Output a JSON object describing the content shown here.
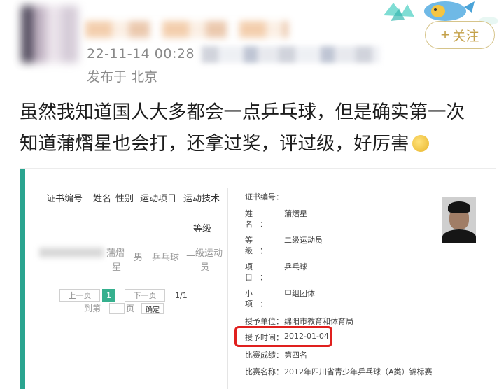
{
  "post": {
    "timestamp": "22-11-14 00:28",
    "location": "发布于 北京",
    "follow_label": "关注",
    "text_line1": "虽然我知道国人大多都会一点乒乓球，但是确实第一次",
    "text_line2": "知道蒲熠星也会打，还拿过奖，评过级，好厉害"
  },
  "certificate_table": {
    "headers": [
      "证书编号",
      "姓名",
      "性别",
      "运动项目",
      "运动技术",
      "等级"
    ],
    "row": {
      "name": [
        "蒲熠",
        "星"
      ],
      "gender": "男",
      "sport": "乒乓球",
      "level": [
        "二级运动",
        "员"
      ]
    },
    "pager": {
      "prev": "上一页",
      "current": "1",
      "next": "下一页",
      "total": "1/1",
      "goto_prefix": "到第",
      "goto_suffix": "页",
      "confirm": "确定"
    }
  },
  "certificate_detail": {
    "cert_no_label": "证书编号：",
    "name_label": [
      "姓",
      "名",
      "："
    ],
    "name_value": "蒲熠星",
    "level_label": [
      "等",
      "级",
      "："
    ],
    "level_value": "二级运动员",
    "sport_label": [
      "项",
      "目",
      "："
    ],
    "sport_value": "乒乓球",
    "sub_label": [
      "小",
      "项",
      "："
    ],
    "sub_value": "甲组团体",
    "issuer_label": "授予单位：",
    "issuer_value": "绵阳市教育和体育局",
    "date_label": "授予时间：",
    "date_value": "2012-01-04",
    "result_label": "比赛成绩：",
    "result_value": "第四名",
    "event_label": "比赛名称：",
    "event_value": "2012年四川省青少年乒乓球（A类）锦标赛"
  },
  "colors": {
    "accent": "#2aa48f",
    "highlight": "#e0201e",
    "follow": "#c4a14a"
  }
}
